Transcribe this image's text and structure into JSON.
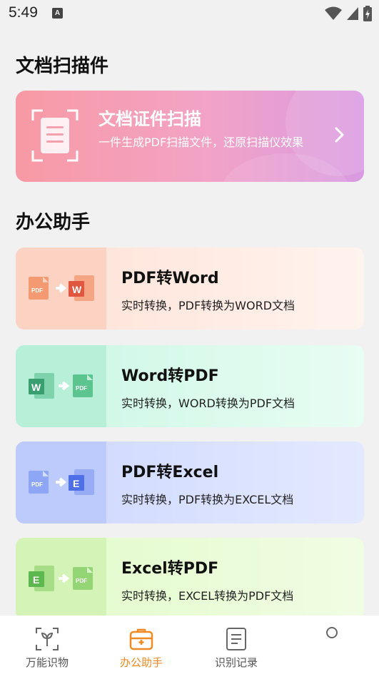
{
  "status_bar": {
    "time": "5:49",
    "notification_icon": "a-notification-icon",
    "wifi_icon": "wifi-icon",
    "signal_icon": "cell-signal-icon",
    "battery_icon": "battery-charging-icon"
  },
  "scan_section": {
    "title": "文档扫描件",
    "card": {
      "title": "文档证件扫描",
      "subtitle": "一件生成PDF扫描文件，还原扫描仪效果",
      "icon": "document-scan-icon",
      "arrow_icon": "chevron-right-icon"
    }
  },
  "office_section": {
    "title": "办公助手",
    "cards": [
      {
        "title": "PDF转Word",
        "subtitle": "实时转换，PDF转换为WORD文档",
        "from": "PDF",
        "to": "W"
      },
      {
        "title": "Word转PDF",
        "subtitle": "实时转换，WORD转换为PDF文档",
        "from": "W",
        "to": "PDF"
      },
      {
        "title": "PDF转Excel",
        "subtitle": "实时转换，PDF转换为EXCEL文档",
        "from": "PDF",
        "to": "E"
      },
      {
        "title": "Excel转PDF",
        "subtitle": "实时转换，EXCEL转换为PDF文档",
        "from": "E",
        "to": "PDF"
      }
    ]
  },
  "bottom_nav": {
    "items": [
      {
        "label": "万能识物",
        "icon": "sprout-scan-icon",
        "active": false
      },
      {
        "label": "办公助手",
        "icon": "briefcase-icon",
        "active": true
      },
      {
        "label": "识别记录",
        "icon": "document-list-icon",
        "active": false
      },
      {
        "label": "",
        "icon": "profile-icon",
        "active": false
      }
    ]
  },
  "colors": {
    "accent": "#f08a24",
    "pdf": "#f47c4d",
    "word": "#e0563e",
    "word_blue": "#2f9e6a",
    "excel": "#4e6fe5",
    "excel_green": "#5cb84e"
  }
}
